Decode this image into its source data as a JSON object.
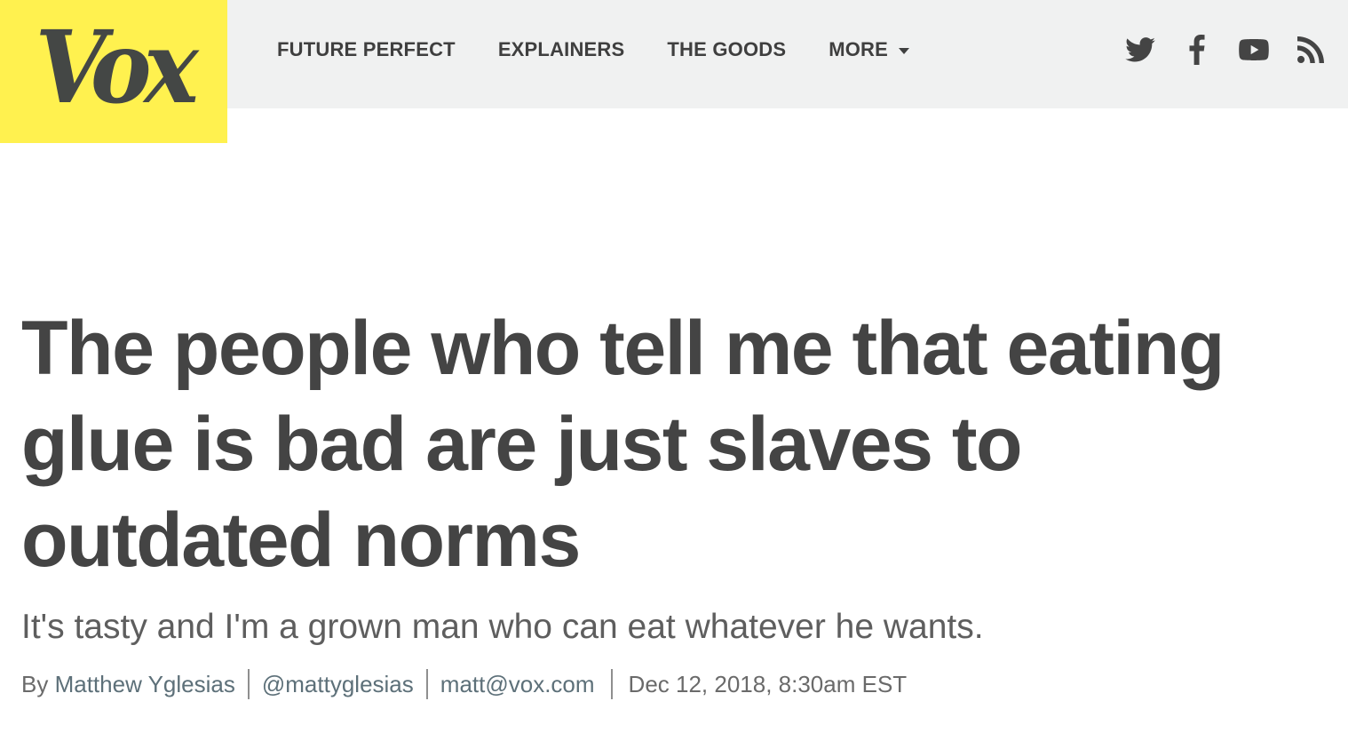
{
  "header": {
    "logo_text": "Vox",
    "nav": [
      {
        "label": "FUTURE PERFECT"
      },
      {
        "label": "EXPLAINERS"
      },
      {
        "label": "THE GOODS"
      },
      {
        "label": "MORE"
      }
    ],
    "social_icons": [
      "twitter-icon",
      "facebook-icon",
      "youtube-icon",
      "rss-icon"
    ]
  },
  "article": {
    "headline": "The people who tell me that eating glue is bad are just slaves to outdated norms",
    "dek": "It's tasty and I'm a grown man who can eat whatever he wants.",
    "byline": {
      "prefix": "By",
      "author": "Matthew Yglesias",
      "twitter": "@mattyglesias",
      "email": "matt@vox.com",
      "timestamp": "Dec 12, 2018, 8:30am EST"
    }
  },
  "colors": {
    "logo_background": "#fff14f",
    "header_background": "#f0f1f1",
    "headline_text": "#444444",
    "byline_link": "#5d7079"
  }
}
